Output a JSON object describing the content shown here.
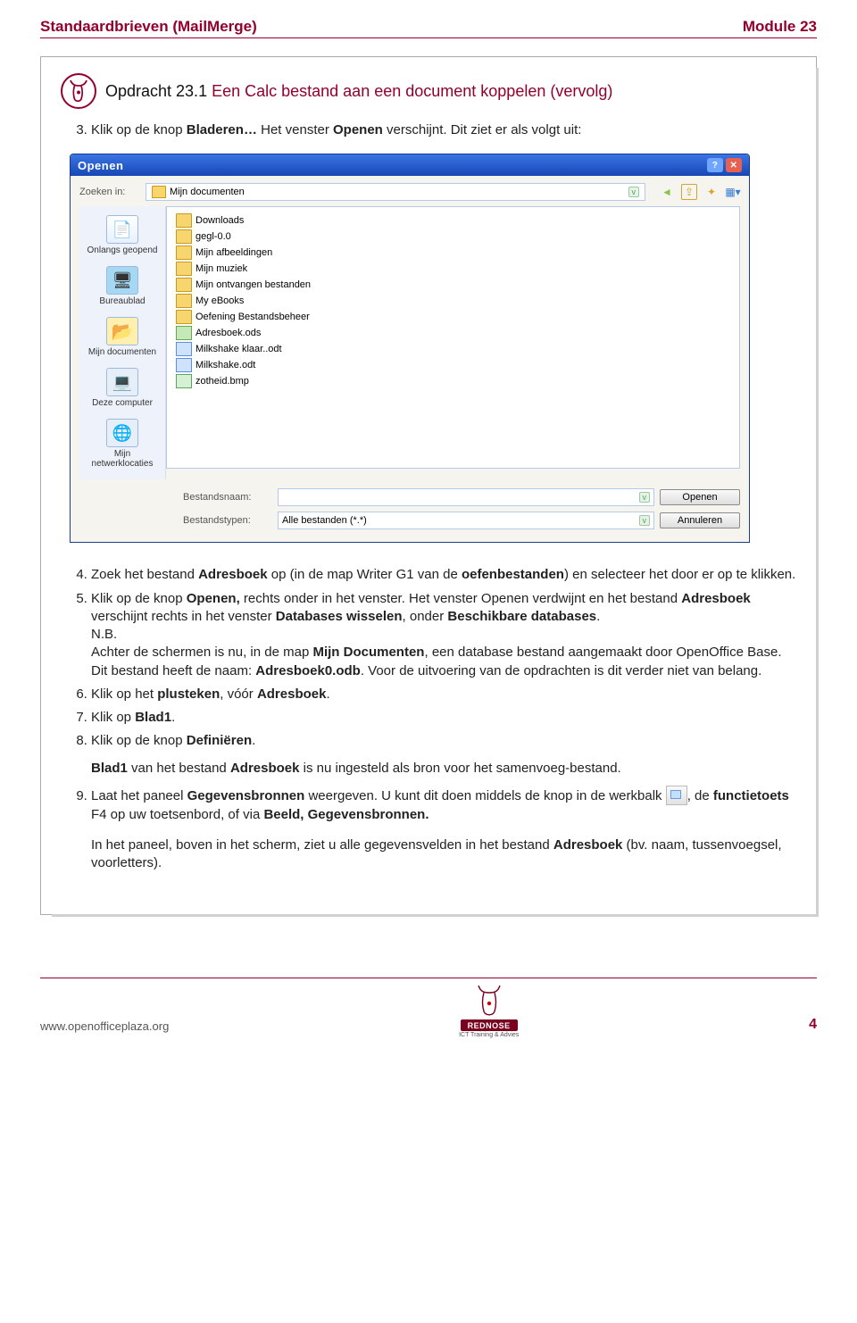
{
  "header": {
    "left": "Standaardbrieven (MailMerge)",
    "right": "Module 23"
  },
  "opdracht": {
    "prefix": "Opdracht 23.1",
    "rest": " Een Calc bestand aan een document koppelen (vervolg)"
  },
  "step3": {
    "a": "Klik op de knop ",
    "bladeren": "Bladeren…",
    "b": " Het venster ",
    "openen": "Openen",
    "c": " verschijnt. Dit ziet er als volgt uit:"
  },
  "dialog": {
    "title": "Openen",
    "lookin_label": "Zoeken in:",
    "lookin_value": "Mijn documenten",
    "places": {
      "recent": "Onlangs geopend",
      "desktop": "Bureaublad",
      "mydocs": "Mijn documenten",
      "computer": "Deze computer",
      "network": "Mijn netwerklocaties"
    },
    "files": [
      {
        "type": "folder",
        "name": "Downloads"
      },
      {
        "type": "folder",
        "name": "gegl-0.0"
      },
      {
        "type": "folder",
        "name": "Mijn afbeeldingen"
      },
      {
        "type": "folder",
        "name": "Mijn muziek"
      },
      {
        "type": "folder",
        "name": "Mijn ontvangen bestanden"
      },
      {
        "type": "folder",
        "name": "My eBooks"
      },
      {
        "type": "folder",
        "name": "Oefening Bestandsbeheer"
      },
      {
        "type": "ods",
        "name": "Adresboek.ods"
      },
      {
        "type": "odt",
        "name": "Milkshake klaar..odt"
      },
      {
        "type": "odt",
        "name": "Milkshake.odt"
      },
      {
        "type": "bmp",
        "name": "zotheid.bmp"
      }
    ],
    "filename_label": "Bestandsnaam:",
    "filetype_label": "Bestandstypen:",
    "filetype_value": "Alle bestanden (*.*)",
    "open_btn": "Openen",
    "cancel_btn": "Annuleren"
  },
  "step4": {
    "a": "Zoek het bestand ",
    "adresboek": "Adresboek",
    "b": " op (in de map Writer G1 van de ",
    "oefen": "oefenbestanden",
    "c": ") en selecteer het door er op te klikken."
  },
  "step5": {
    "a": "Klik op de knop ",
    "openen": "Openen,",
    "b": " rechts onder in het venster. Het venster Openen verdwijnt en het bestand  ",
    "adresboek": "Adresboek",
    "c": " verschijnt rechts in het venster ",
    "dbw": "Databases wisselen",
    "d": ", onder ",
    "besch": "Beschikbare databases",
    "dot": ".",
    "nb": "N.B.",
    "nbline1a": "Achter de schermen is nu, in de map ",
    "mijndoc": "Mijn Documenten",
    "nbline1b": ", een database bestand aangemaakt door OpenOffice Base. Dit bestand heeft de naam: ",
    "adresb0": "Adresboek0.odb",
    "nbline1c": ". Voor de uitvoering van de opdrachten is dit verder niet van belang."
  },
  "step6": {
    "a": "Klik op het ",
    "plus": "plusteken",
    "b": ", vóór ",
    "adresboek": "Adresboek",
    "dot": "."
  },
  "step7": {
    "a": "Klik op ",
    "blad1": "Blad1",
    "dot": "."
  },
  "step8": {
    "a": "Klik op de knop ",
    "def": "Definiëren",
    "dot": ".",
    "resulta": "Blad1",
    "resultb": " van het bestand ",
    "adresboek": "Adresboek",
    "resultc": " is nu ingesteld als bron voor het samenvoeg-bestand."
  },
  "step9": {
    "a": "Laat het paneel ",
    "geg": "Gegevensbronnen",
    "b": " weergeven. U kunt dit doen middels de knop in de werkbalk ",
    "c": ", de ",
    "func": "functietoets",
    "d": " F4 op uw toetsenbord, of via ",
    "beeld": "Beeld, Gegevensbronnen.",
    "p2a": "In het paneel, boven in het scherm, ziet u alle gegevensvelden in het bestand ",
    "adresboek": "Adresboek",
    "p2b": " (bv. naam, tussenvoegsel, voorletters)."
  },
  "footer": {
    "url": "www.openofficeplaza.org",
    "page": "4",
    "logo": "REDNOSE",
    "logo_sub": "ICT Training & Advies"
  }
}
